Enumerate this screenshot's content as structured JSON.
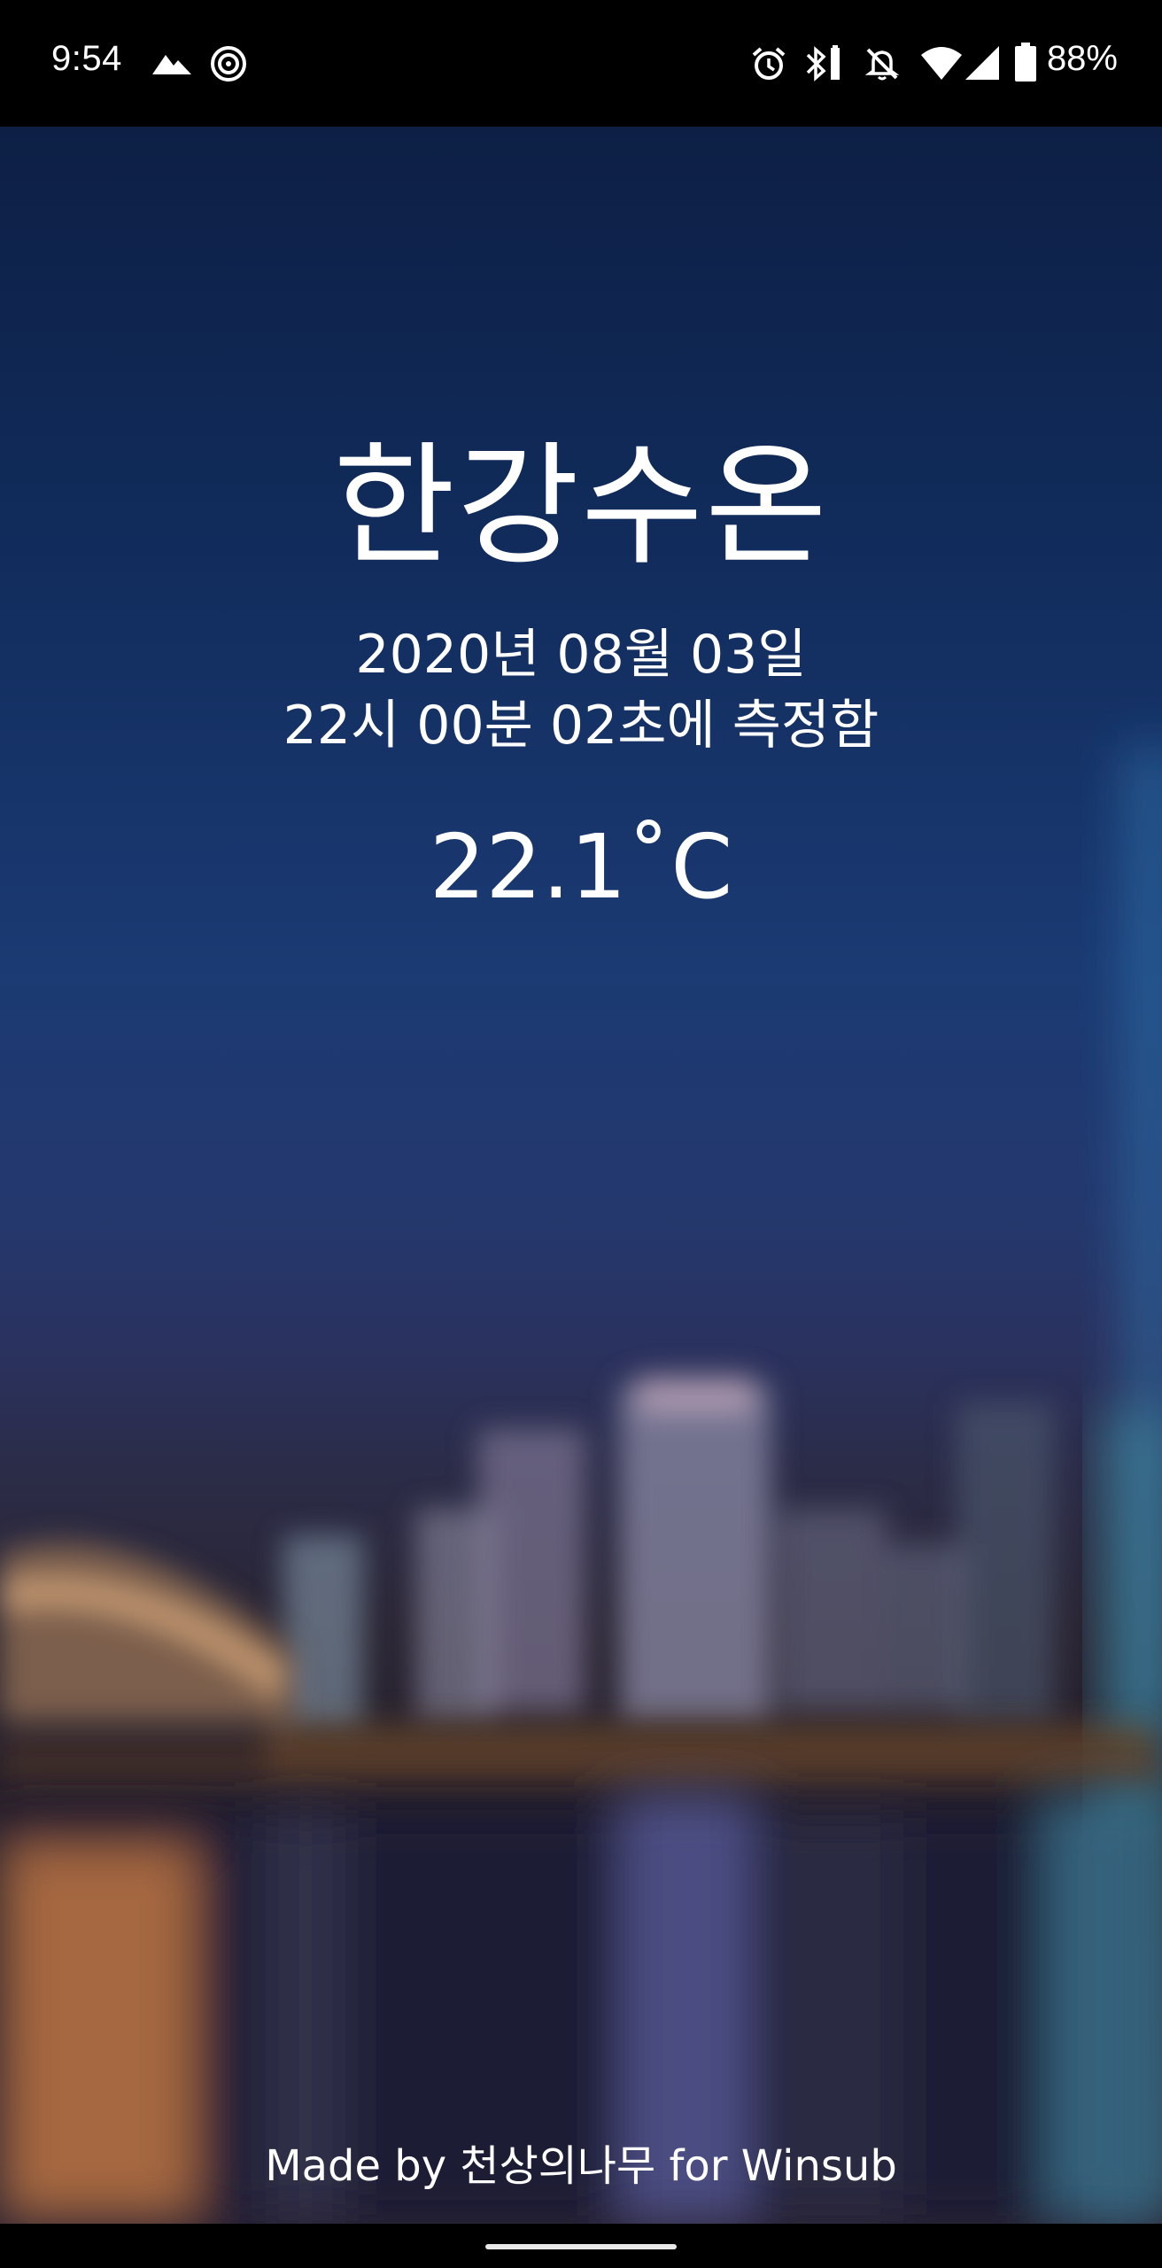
{
  "status_bar": {
    "time": "9:54",
    "battery_percent": "88%",
    "left_icons": [
      "mountain-icon",
      "target-icon"
    ],
    "right_icons": [
      "alarm-icon",
      "bluetooth-icon",
      "notifications-off-icon",
      "wifi-icon",
      "cellular-signal-icon",
      "battery-icon"
    ]
  },
  "main": {
    "title": "한강수온",
    "date_line_1": "2020년 08월 03일",
    "date_line_2": "22시 00분 02초에 측정함",
    "temperature": "22.1˚C"
  },
  "footer": {
    "credits": "Made by 천상의나무 for Winsub"
  },
  "colors": {
    "sky_top": "#0d1f45",
    "sky_mid": "#1b3a73",
    "text": "#ffffff"
  }
}
